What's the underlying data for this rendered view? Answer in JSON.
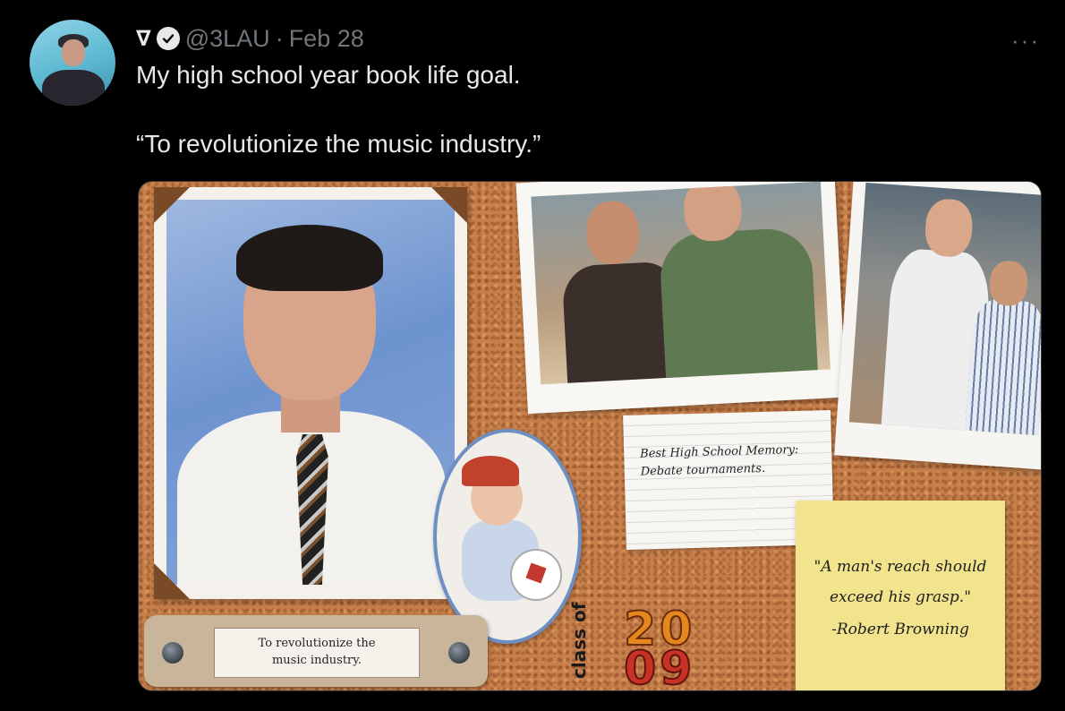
{
  "tweet": {
    "name_glyph": "∇",
    "verified_icon": "verified-badge-icon",
    "handle": "@3LAU",
    "separator": "·",
    "date": "Feb 28",
    "more_label": "···",
    "text_line_1": "My high school year book life goal.",
    "text_line_2": "“To revolutionize the music industry.”"
  },
  "media": {
    "memo_line_1": "Best High School Memory:",
    "memo_line_2": "Debate tournaments.",
    "quote_line_1": "\"A man's reach should",
    "quote_line_2": "exceed his grasp.\"",
    "quote_line_3": "-Robert Browning",
    "plaque_line_1": "To revolutionize the",
    "plaque_line_2": "music industry.",
    "class_of": "class of",
    "year_top": "20",
    "year_bottom": "09"
  },
  "colors": {
    "background": "#000000",
    "text_primary": "#e7e9ea",
    "text_secondary": "#71767b",
    "cork": "#c77f4b",
    "sticky_note": "#f2e48c"
  }
}
